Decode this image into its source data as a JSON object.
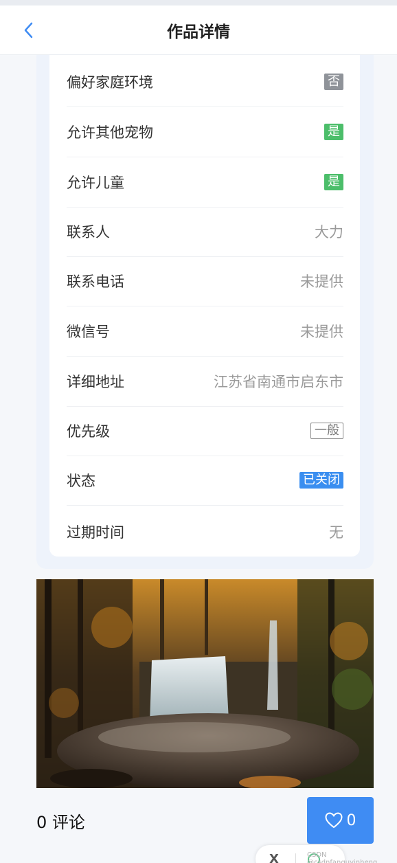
{
  "header": {
    "title": "作品详情",
    "back_icon": "chevron-left-icon"
  },
  "details": [
    {
      "label": "偏好家庭环境",
      "value": "否",
      "type": "badge",
      "color": "#8f9399"
    },
    {
      "label": "允许其他宠物",
      "value": "是",
      "type": "badge",
      "color": "#4cbe6a"
    },
    {
      "label": "允许儿童",
      "value": "是",
      "type": "badge",
      "color": "#4cbe6a"
    },
    {
      "label": "联系人",
      "value": "大力",
      "type": "text"
    },
    {
      "label": "联系电话",
      "value": "未提供",
      "type": "text"
    },
    {
      "label": "微信号",
      "value": "未提供",
      "type": "text"
    },
    {
      "label": "详细地址",
      "value": "江苏省南通市启东市",
      "type": "text"
    },
    {
      "label": "优先级",
      "value": "一般",
      "type": "outline-badge"
    },
    {
      "label": "状态",
      "value": "已关闭",
      "type": "badge",
      "color": "#3a8ef0"
    },
    {
      "label": "过期时间",
      "value": "无",
      "type": "text"
    }
  ],
  "footer": {
    "comments_label": "0 评论",
    "like_icon": "heart-outline-icon",
    "like_count": "0"
  },
  "watermark": "CSDN @csdnfanguyinheng",
  "colors": {
    "accent": "#3f8cf3",
    "card_bg": "#eef3fb"
  }
}
